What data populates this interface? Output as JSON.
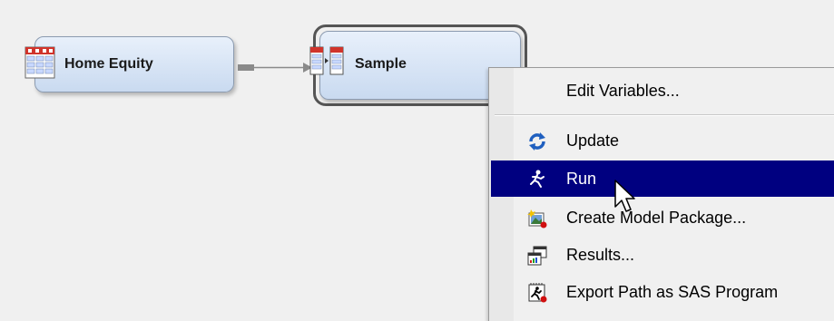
{
  "diagram": {
    "nodes": [
      {
        "label": "Home Equity",
        "icon": "data-table-icon"
      },
      {
        "label": "Sample",
        "icon": "sample-icon",
        "selected": true
      }
    ]
  },
  "context_menu": {
    "items": [
      {
        "label": "Edit Variables...",
        "icon": ""
      },
      {
        "label": "Update",
        "icon": "update-icon"
      },
      {
        "label": "Run",
        "icon": "run-icon",
        "highlighted": true
      },
      {
        "label": "Create Model Package...",
        "icon": "model-package-icon"
      },
      {
        "label": "Results...",
        "icon": "results-icon"
      },
      {
        "label": "Export Path as SAS Program",
        "icon": "export-sas-icon"
      }
    ]
  },
  "colors": {
    "canvas_bg": "#f0f0f0",
    "node_fill_top": "#e8f0fb",
    "node_fill_bottom": "#c9daf0",
    "menu_highlight": "#000080"
  }
}
